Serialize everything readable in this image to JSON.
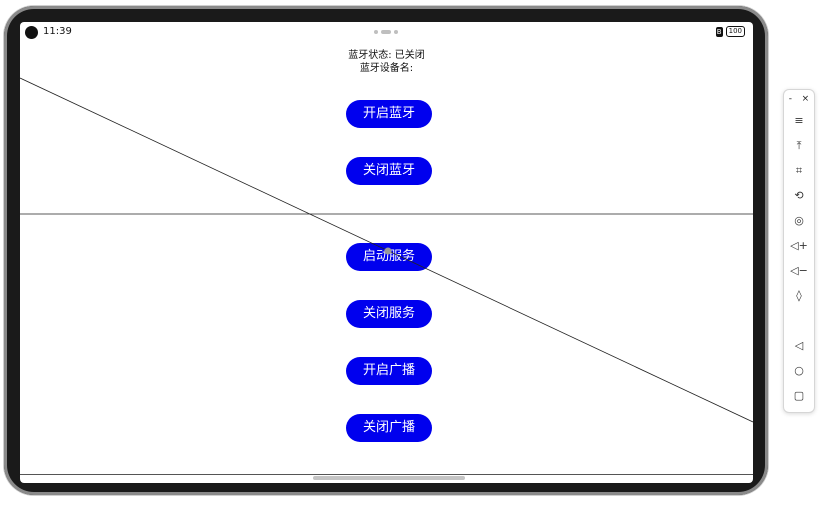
{
  "status": {
    "time": "11:39",
    "bluetooth_badge": "B",
    "battery": "100"
  },
  "info": {
    "bt_state_label": "蓝牙状态: 已关闭",
    "bt_device_name_label": "蓝牙设备名:"
  },
  "buttons": {
    "enable_bt": "开启蓝牙",
    "disable_bt": "关闭蓝牙",
    "start_service": "启动服务",
    "stop_service": "关闭服务",
    "start_advertising": "开启广播",
    "stop_advertising": "关闭广播"
  },
  "toolbar": {
    "minimize": "-",
    "close": "×",
    "items": [
      {
        "name": "menu-icon",
        "glyph": "≡"
      },
      {
        "name": "pin-top-icon",
        "glyph": "⤒"
      },
      {
        "name": "crop-icon",
        "glyph": "⌗"
      },
      {
        "name": "rotate-icon",
        "glyph": "⟲"
      },
      {
        "name": "screenshot-icon",
        "glyph": "◎"
      },
      {
        "name": "volume-up-icon",
        "glyph": "◁+"
      },
      {
        "name": "volume-down-icon",
        "glyph": "◁−"
      },
      {
        "name": "shake-icon",
        "glyph": "◊"
      }
    ],
    "nav": [
      {
        "name": "back-icon",
        "glyph": "◁"
      },
      {
        "name": "home-icon",
        "glyph": "○"
      },
      {
        "name": "recents-icon",
        "glyph": "▢"
      }
    ]
  },
  "colors": {
    "button_bg": "#0000ee",
    "button_text": "#ffffff"
  }
}
